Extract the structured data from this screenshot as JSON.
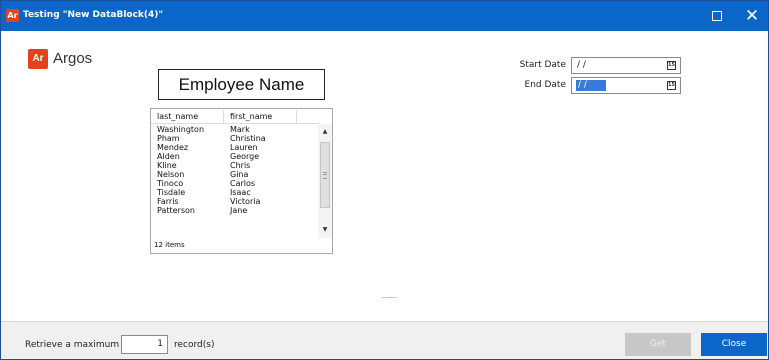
{
  "window": {
    "app_icon_text": "Ar",
    "title": "Testing \"New DataBlock(4)\"",
    "maximize_glyph": "☐",
    "close_glyph": "✕"
  },
  "logo": {
    "mark_text": "Ar",
    "word": "Argos"
  },
  "form": {
    "heading": "Employee Name",
    "start_date": {
      "label": "Start Date",
      "value": " / /",
      "icon": "calendar-icon",
      "icon_text": "15"
    },
    "end_date": {
      "label": "End Date",
      "value": " / /",
      "selected": true,
      "icon": "calendar-icon",
      "icon_text": "15"
    }
  },
  "employee_list": {
    "columns": [
      "last_name",
      "first_name"
    ],
    "rows": [
      {
        "last_name": "Washington",
        "first_name": "Mark"
      },
      {
        "last_name": "Pham",
        "first_name": "Christina"
      },
      {
        "last_name": "Mendez",
        "first_name": "Lauren"
      },
      {
        "last_name": "Alden",
        "first_name": "George"
      },
      {
        "last_name": "Kline",
        "first_name": "Chris"
      },
      {
        "last_name": "Nelson",
        "first_name": "Gina"
      },
      {
        "last_name": "Tinoco",
        "first_name": "Carlos"
      },
      {
        "last_name": "Tisdale",
        "first_name": "Isaac"
      },
      {
        "last_name": "Farris",
        "first_name": "Victoria"
      },
      {
        "last_name": "Patterson",
        "first_name": "Jane"
      }
    ],
    "count_text": "12 items",
    "scroll_up_glyph": "▲",
    "scroll_down_glyph": "▼"
  },
  "splitter_glyph": "..........",
  "footer": {
    "retrieve_label": "Retrieve a maximum",
    "max_records": "1",
    "records_suffix": "record(s)",
    "get_label": "Get",
    "close_label": "Close"
  },
  "colors": {
    "titlebar": "#0a67c9",
    "brand_red": "#e4411f",
    "primary_button": "#0a67c9",
    "disabled_button": "#c7c7c7",
    "selection": "#3a78d9"
  }
}
